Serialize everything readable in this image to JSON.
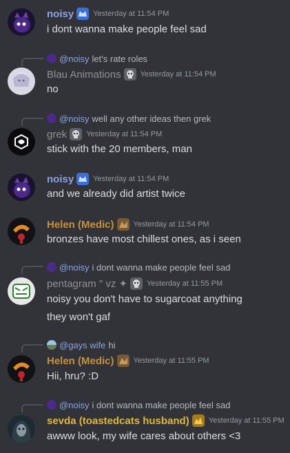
{
  "colors": {
    "background": "#313338",
    "noisy": "#8ea1e1",
    "gray_name": "#8e9297",
    "helen": "#c7913c",
    "sevda": "#e0b73b",
    "mention": "#8da5e8",
    "timestamp": "#949ba4"
  },
  "messages": [
    {
      "author": "noisy",
      "timestamp": "Yesterday at 11:54 PM",
      "content": "i dont wanna make people feel sad",
      "role_icon": "cat-icon"
    },
    {
      "reply": {
        "mention": "@noisy",
        "text": "let's rate roles"
      },
      "author": "Blau Animations",
      "timestamp": "Yesterday at 11:54 PM",
      "content": "no",
      "role_icon": "skull-icon"
    },
    {
      "reply": {
        "mention": "@noisy",
        "text": "well any other ideas then grek"
      },
      "author": "grek",
      "timestamp": "Yesterday at 11:54 PM",
      "content": "stick with the 20 members, man",
      "role_icon": "skull-icon"
    },
    {
      "author": "noisy",
      "timestamp": "Yesterday at 11:54 PM",
      "content": "and we already did artist twice",
      "role_icon": "cat-icon"
    },
    {
      "author": "Helen (Medic)",
      "timestamp": "Yesterday at 11:54 PM",
      "content": "bronzes have most chillest ones, as i seen",
      "role_icon": "bronze-icon"
    },
    {
      "reply": {
        "mention": "@noisy",
        "text": "i dont wanna make people feel sad"
      },
      "author": "pentagram ″ vz ✦",
      "timestamp": "Yesterday at 11:55 PM",
      "content": "noisy you don't have to sugarcoat anything",
      "content2": "they won't gaf",
      "role_icon": "skull-icon"
    },
    {
      "reply": {
        "mention": "@gays wife",
        "text": "hi"
      },
      "author": "Helen (Medic)",
      "timestamp": "Yesterday at 11:55 PM",
      "content": "Hii, hru? :D",
      "role_icon": "bronze-icon"
    },
    {
      "reply": {
        "mention": "@noisy",
        "text": "i dont wanna make people feel sad"
      },
      "author": "sevda (toastedcats husband)",
      "timestamp": "Yesterday at 11:55 PM",
      "content": "awww look, my wife cares about others <3",
      "role_icon": "gold-icon"
    }
  ]
}
